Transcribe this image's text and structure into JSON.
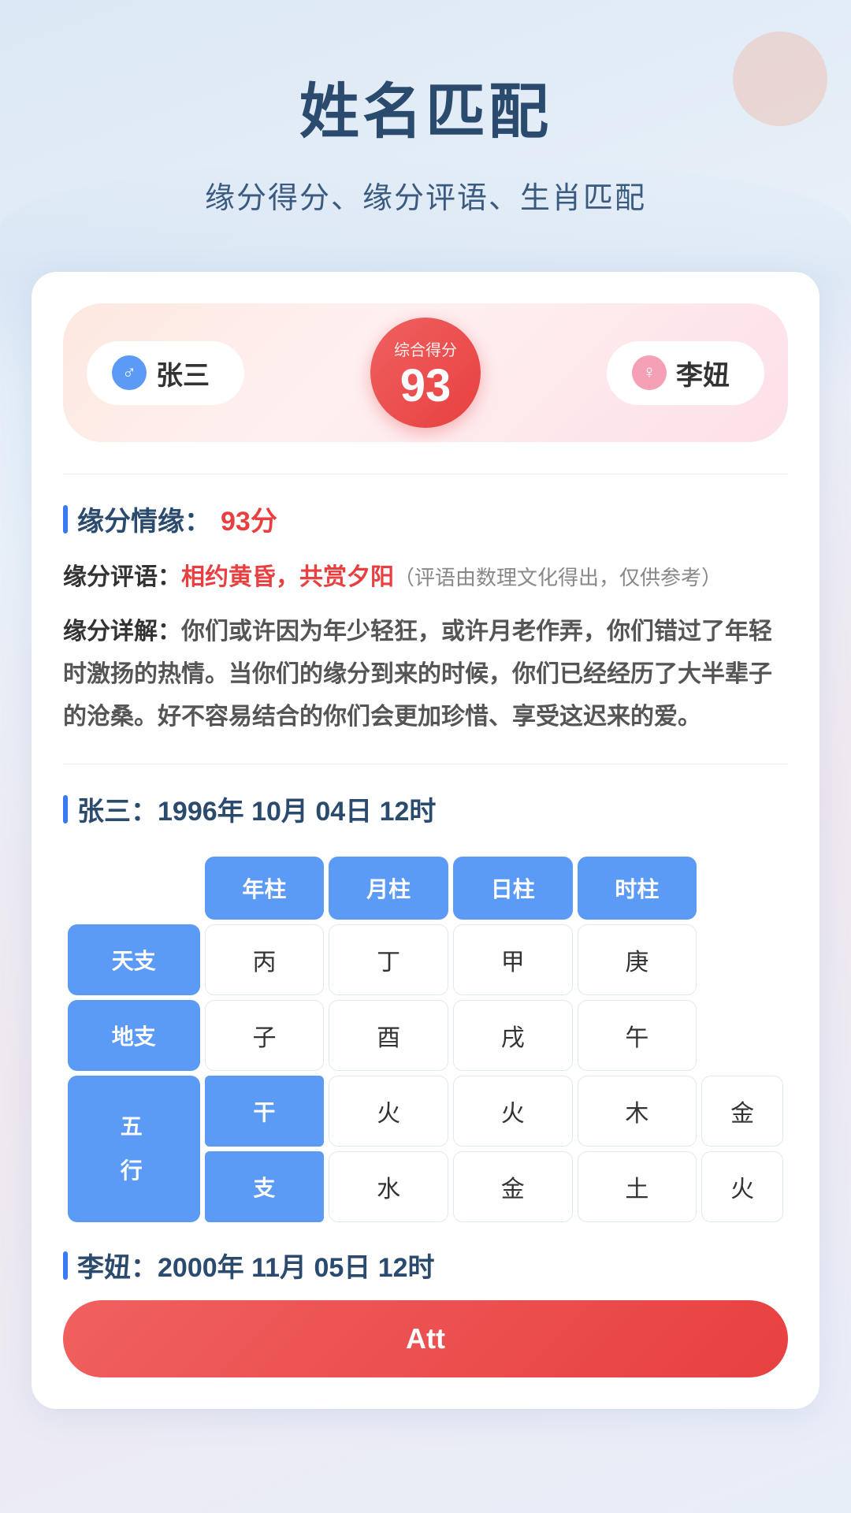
{
  "page": {
    "title": "姓名匹配",
    "subtitle": "缘分得分、缘分评语、生肖匹配"
  },
  "score_header": {
    "person1": {
      "name": "张三",
      "gender": "male",
      "gender_symbol": "♂"
    },
    "person2": {
      "name": "李妞",
      "gender": "female",
      "gender_symbol": "♀"
    },
    "score_label": "综合得分",
    "score_value": "93"
  },
  "result": {
    "yuanfen_label": "缘分情缘：",
    "yuanfen_score": "93分",
    "eval_label": "缘分评语：",
    "eval_phrase": "相约黄昏，共赏夕阳",
    "eval_note": "（评语由数理文化得出，仅供参考）",
    "detail_label": "缘分详解：",
    "detail_text": "你们或许因为年少轻狂，或许月老作弄，你们错过了年轻时激扬的热情。当你们的缘分到来的时候，你们已经经历了大半辈子的沧桑。好不容易结合的你们会更加珍惜、享受这迟来的爱。"
  },
  "person1_chart": {
    "name": "张三",
    "date": "1996年 10月 04日 12时",
    "columns": [
      "年柱",
      "月柱",
      "日柱",
      "时柱"
    ],
    "tiangan": [
      "丙",
      "丁",
      "甲",
      "庚"
    ],
    "dizhi": [
      "子",
      "酉",
      "戌",
      "午"
    ],
    "wuxing_gan": [
      "火",
      "火",
      "木",
      "金"
    ],
    "wuxing_zhi": [
      "水",
      "金",
      "土",
      "火"
    ],
    "row_labels": {
      "tiangan": "天支",
      "dizhi": "地支",
      "wuxing": "五行",
      "gan": "干",
      "zhi": "支"
    }
  },
  "person2_label": "李妞：2000年 11月 05日 12时",
  "bottom_button_label": "Att"
}
